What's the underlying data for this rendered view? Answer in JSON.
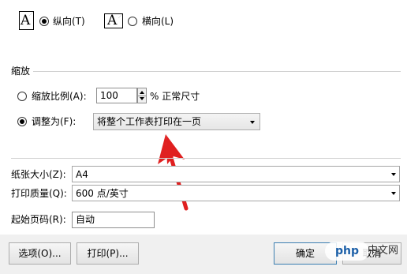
{
  "orientation": {
    "portrait_label": "纵向(T)",
    "landscape_label": "横向(L)",
    "selected": "portrait"
  },
  "scaling": {
    "group_title": "缩放",
    "scale_option_label": "缩放比例(A):",
    "scale_value": "100",
    "scale_suffix": "% 正常尺寸",
    "fit_option_label": "调整为(F):",
    "fit_value": "将整个工作表打印在一页",
    "selected": "fit"
  },
  "paper": {
    "size_label": "纸张大小(Z):",
    "size_value": "A4",
    "quality_label": "打印质量(Q):",
    "quality_value": "600 点/英寸",
    "first_page_label": "起始页码(R):",
    "first_page_value": "自动"
  },
  "buttons": {
    "options": "选项(O)...",
    "print": "打印(P)...",
    "ok": "确定",
    "cancel": "取消"
  },
  "watermark": {
    "logo_text": "php",
    "site_text": "中文网"
  },
  "colors": {
    "arrow": "#e02020",
    "default_button_border": "#3c7fb1"
  }
}
